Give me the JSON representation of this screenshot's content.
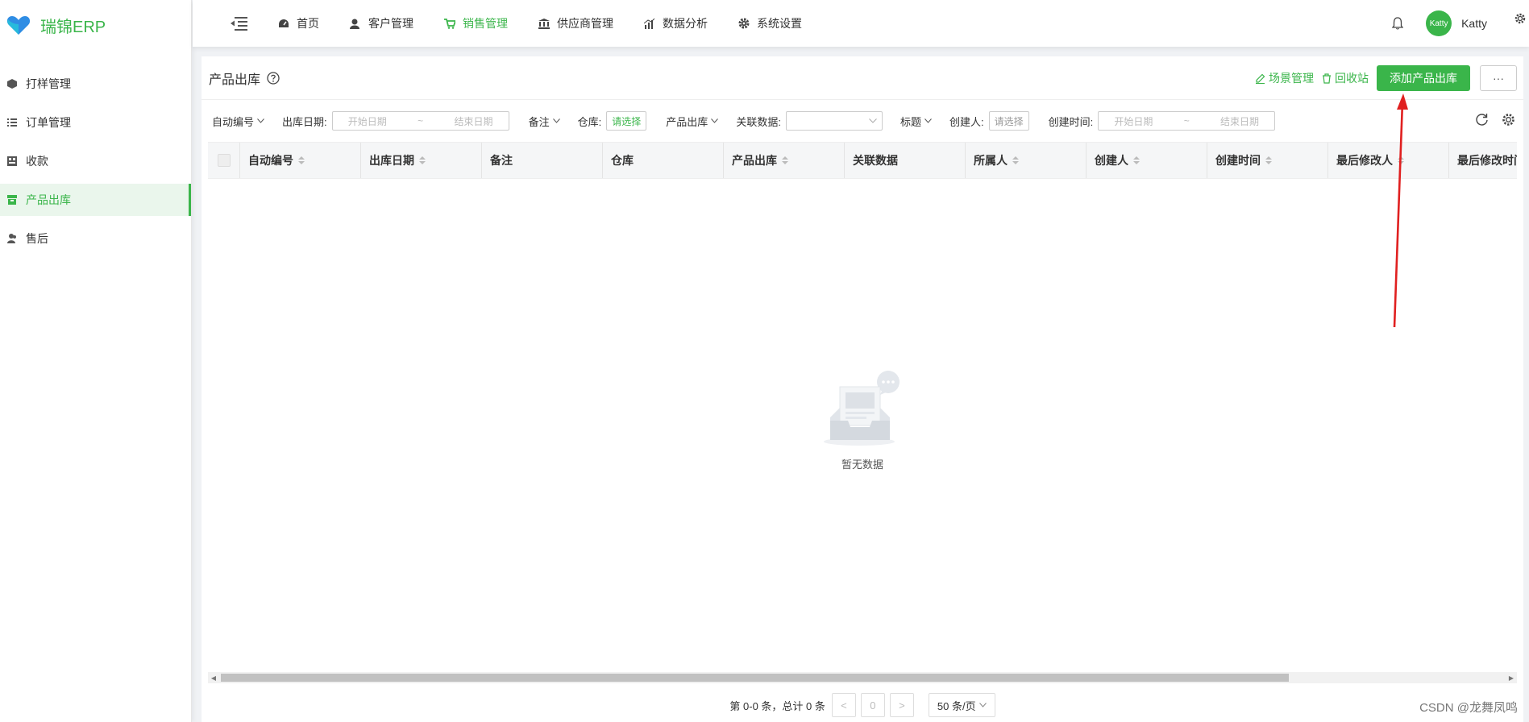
{
  "app": {
    "name": "瑞锦ERP",
    "brand_color": "#3ab54a"
  },
  "sidebar": {
    "items": [
      {
        "label": "打样管理",
        "icon": "cube-icon",
        "active": false
      },
      {
        "label": "订单管理",
        "icon": "list-icon",
        "active": false
      },
      {
        "label": "收款",
        "icon": "ledger-icon",
        "active": false
      },
      {
        "label": "产品出库",
        "icon": "box-icon",
        "active": true
      },
      {
        "label": "售后",
        "icon": "users-icon",
        "active": false
      }
    ]
  },
  "topnav": {
    "items": [
      {
        "label": "首页",
        "icon": "dashboard-icon",
        "active": false
      },
      {
        "label": "客户管理",
        "icon": "user-icon",
        "active": false
      },
      {
        "label": "销售管理",
        "icon": "cart-icon",
        "active": true
      },
      {
        "label": "供应商管理",
        "icon": "bank-icon",
        "active": false
      },
      {
        "label": "数据分析",
        "icon": "chart-icon",
        "active": false
      },
      {
        "label": "系统设置",
        "icon": "gear-icon",
        "active": false
      }
    ],
    "user": {
      "avatar_text": "Katty",
      "name": "Katty"
    }
  },
  "panel": {
    "title": "产品出库",
    "actions": {
      "scene": "场景管理",
      "recycle": "回收站",
      "add": "添加产品出库",
      "more": "···"
    }
  },
  "filters": {
    "auto_no": "自动编号",
    "out_date_label": "出库日期:",
    "start_placeholder": "开始日期",
    "tilde": "~",
    "end_placeholder": "结束日期",
    "remark": "备注",
    "warehouse_label": "仓库:",
    "warehouse_value": "请选择",
    "product_out": "产品出库",
    "related_label": "关联数据:",
    "title": "标题",
    "creator_label": "创建人:",
    "creator_value": "请选择",
    "created_time_label": "创建时间:",
    "created_start": "开始日期",
    "created_end": "结束日期"
  },
  "table": {
    "columns": [
      {
        "label": "自动编号",
        "sortable": true
      },
      {
        "label": "出库日期",
        "sortable": true
      },
      {
        "label": "备注",
        "sortable": false
      },
      {
        "label": "仓库",
        "sortable": false
      },
      {
        "label": "产品出库",
        "sortable": true
      },
      {
        "label": "关联数据",
        "sortable": false
      },
      {
        "label": "所属人",
        "sortable": true
      },
      {
        "label": "创建人",
        "sortable": true
      },
      {
        "label": "创建时间",
        "sortable": true
      },
      {
        "label": "最后修改人",
        "sortable": true
      },
      {
        "label": "最后修改时间",
        "sortable": false
      }
    ],
    "rows": [],
    "empty_text": "暂无数据"
  },
  "pagination": {
    "info": "第 0-0 条，总计 0 条",
    "prev": "<",
    "page": "0",
    "next": ">",
    "page_size": "50 条/页"
  },
  "watermark": "CSDN @龙舞凤鸣"
}
